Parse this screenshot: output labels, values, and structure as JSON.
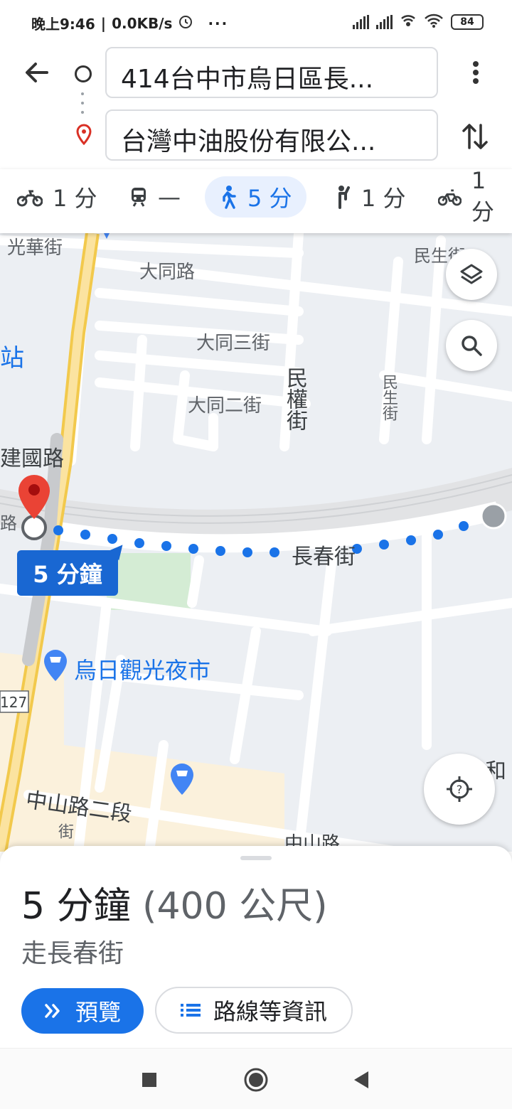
{
  "status_bar": {
    "time": "晚上9:46",
    "speed": "0.0KB/s",
    "battery": "84",
    "icons": [
      "alarm-icon",
      "more-icon",
      "signal-icon",
      "signal-icon",
      "hotspot-icon",
      "wifi-icon",
      "battery-icon"
    ]
  },
  "header": {
    "origin": "414台中市烏日區長...",
    "destination": "台灣中油股份有限公..."
  },
  "modes": [
    {
      "name": "motorcycle",
      "label": "1 分",
      "active": false
    },
    {
      "name": "transit",
      "label": "—",
      "active": false
    },
    {
      "name": "walk",
      "label": "5 分",
      "active": true
    },
    {
      "name": "ride",
      "label": "1 分",
      "active": false
    },
    {
      "name": "bike",
      "label": "1 分",
      "active": false
    }
  ],
  "map": {
    "duration_badge": "5 分鐘",
    "route_street": "長春街",
    "poi": "烏日觀光夜市",
    "streets": {
      "guanghua": "光華街",
      "datong": "大同路",
      "datong3": "大同三街",
      "datong2": "大同二街",
      "minquan": "民權街",
      "minsheng": "民生街",
      "minsheng_top": "民生街",
      "jianguo": "建國路",
      "zhongshan2": "中山路二段",
      "zhongshan": "中山路",
      "station": "站",
      "he": "和",
      "route_no": "127",
      "lu": "路",
      "jie": "街"
    },
    "colors": {
      "route": "#1a73e8",
      "pin": "#d93025",
      "highway": "#f9d77e"
    }
  },
  "sheet": {
    "duration": "5 分鐘",
    "distance": "(400 公尺)",
    "via": "走長春街",
    "preview_label": "預覽",
    "steps_label": "路線等資訊"
  }
}
